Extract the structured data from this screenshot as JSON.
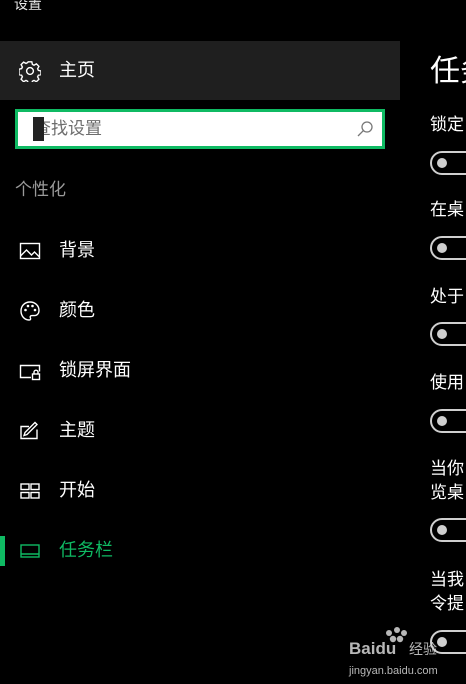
{
  "window": {
    "title": "设置"
  },
  "home": {
    "label": "主页",
    "icon": "gear-icon"
  },
  "search": {
    "placeholder": "查找设置",
    "icon": "search-icon"
  },
  "section": {
    "heading": "个性化"
  },
  "nav_items": [
    {
      "label": "背景",
      "icon": "image-icon",
      "active": false
    },
    {
      "label": "颜色",
      "icon": "palette-icon",
      "active": false
    },
    {
      "label": "锁屏界面",
      "icon": "lock-screen-icon",
      "active": false
    },
    {
      "label": "主题",
      "icon": "theme-icon",
      "active": false
    },
    {
      "label": "开始",
      "icon": "start-icon",
      "active": false
    },
    {
      "label": "任务栏",
      "icon": "taskbar-icon",
      "active": true
    }
  ],
  "content": {
    "title": "任务",
    "settings": [
      {
        "label": "锁定",
        "state": "off"
      },
      {
        "label": "在桌",
        "state": "off"
      },
      {
        "label": "处于",
        "state": "off"
      },
      {
        "label": "使用",
        "state": "off"
      },
      {
        "label_line1": "当你",
        "label_line2": "览桌",
        "state": "off"
      },
      {
        "label_line1": "当我",
        "label_line2": "令提",
        "state": "off"
      }
    ]
  },
  "colors": {
    "accent": "#0fba63",
    "background": "#000000",
    "home_background": "#1f1f1f"
  },
  "watermark": {
    "brand": "Baidu",
    "subtitle": "经验",
    "url": "jingyan.baidu.com"
  }
}
